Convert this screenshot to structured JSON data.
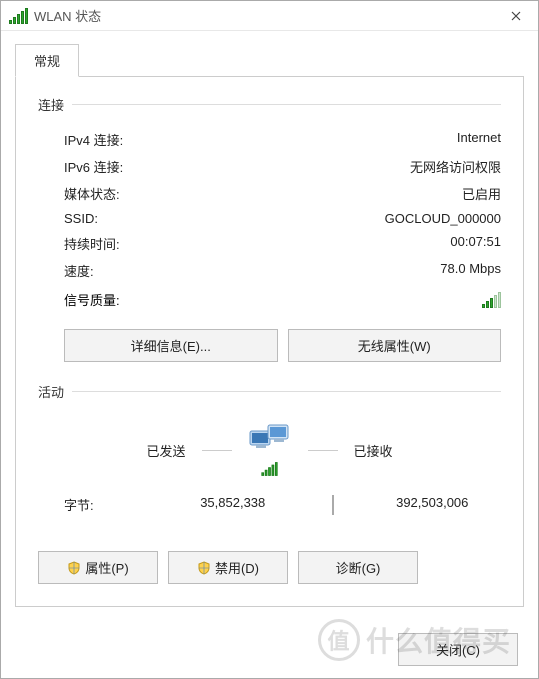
{
  "titlebar": {
    "title": "WLAN 状态"
  },
  "tab": {
    "general": "常规"
  },
  "connection": {
    "header": "连接",
    "ipv4_label": "IPv4 连接:",
    "ipv4_value": "Internet",
    "ipv6_label": "IPv6 连接:",
    "ipv6_value": "无网络访问权限",
    "media_label": "媒体状态:",
    "media_value": "已启用",
    "ssid_label": "SSID:",
    "ssid_value": "GOCLOUD_000000",
    "duration_label": "持续时间:",
    "duration_value": "00:07:51",
    "speed_label": "速度:",
    "speed_value": "78.0 Mbps",
    "signal_label": "信号质量:"
  },
  "buttons": {
    "details": "详细信息(E)...",
    "wireless_props": "无线属性(W)",
    "properties": "属性(P)",
    "disable": "禁用(D)",
    "diagnose": "诊断(G)",
    "close": "关闭(C)"
  },
  "activity": {
    "header": "活动",
    "sent_label": "已发送",
    "received_label": "已接收",
    "bytes_label": "字节:",
    "bytes_sent": "35,852,338",
    "bytes_received": "392,503,006"
  },
  "watermark": {
    "symbol": "值",
    "text": "什么值得买"
  }
}
